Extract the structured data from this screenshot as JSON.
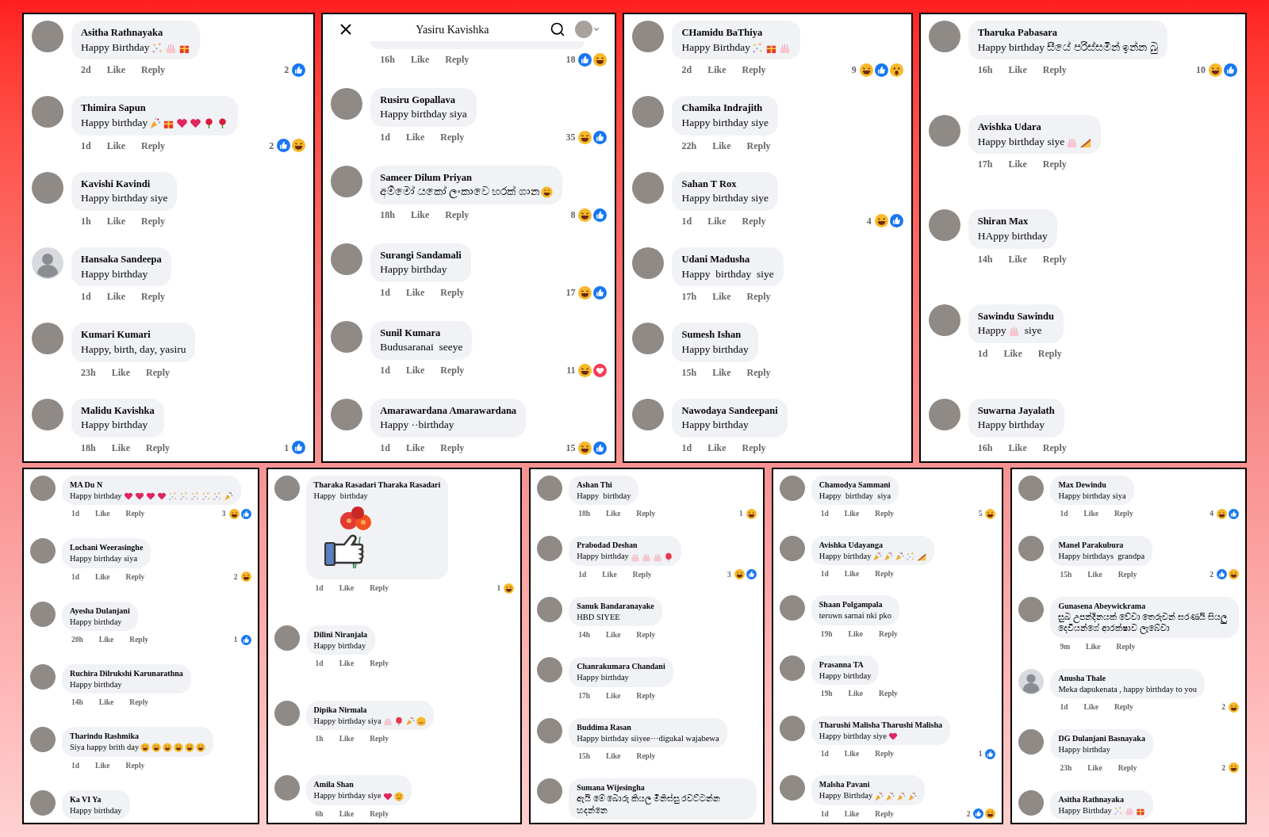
{
  "top_row": [
    {
      "comments": [
        {
          "avatar": {
            "kind": "photo"
          },
          "name": "Asitha Rathnayaka",
          "text": "Happy Birthday",
          "emojis": [
            {
              "kind": "confetti"
            },
            {
              "kind": "cake"
            },
            {
              "kind": "gift"
            }
          ],
          "time": "2d",
          "like": "Like",
          "reply": "Reply",
          "count": "2",
          "reactions": [
            {
              "kind": "like"
            }
          ]
        },
        {
          "avatar": {
            "kind": "photo"
          },
          "name": "Thimira Sapun",
          "text": "Happy birthday",
          "emojis": [
            {
              "kind": "party"
            },
            {
              "kind": "gift"
            },
            {
              "kind": "heart"
            },
            {
              "kind": "heart"
            },
            {
              "kind": "rose"
            },
            {
              "kind": "rose"
            }
          ],
          "time": "1d",
          "like": "Like",
          "reply": "Reply",
          "count": "2",
          "reactions": [
            {
              "kind": "like"
            },
            {
              "kind": "haha"
            }
          ]
        },
        {
          "avatar": {
            "kind": "photo"
          },
          "name": "Kavishi Kavindi",
          "text": "Happy birthday siye",
          "time": "1h",
          "like": "Like",
          "reply": "Reply"
        },
        {
          "avatar": {
            "kind": "default"
          },
          "name": "Hansaka Sandeepa",
          "text": "Happy birthday",
          "time": "1d",
          "like": "Like",
          "reply": "Reply"
        },
        {
          "avatar": {
            "kind": "photo"
          },
          "name": "Kumari Kumari",
          "text": "Happy, birth, day, yasiru",
          "time": "23h",
          "like": "Like",
          "reply": "Reply"
        },
        {
          "avatar": {
            "kind": "photo"
          },
          "name": "Malidu Kavishka",
          "text": "Happy birthday",
          "time": "18h",
          "like": "Like",
          "reply": "Reply",
          "count": "1",
          "reactions": [
            {
              "kind": "like"
            }
          ]
        }
      ]
    },
    {
      "header": {
        "title": "Yasiru Kavishka"
      },
      "comments": [
        {
          "time": "16h",
          "like": "Like",
          "reply": "Reply",
          "count": "18",
          "reactions": [
            {
              "kind": "like"
            },
            {
              "kind": "haha"
            }
          ]
        },
        {
          "avatar": {
            "kind": "photo"
          },
          "name": "Rusiru Gopallava",
          "text": "Happy birthday siya",
          "time": "1d",
          "like": "Like",
          "reply": "Reply",
          "count": "35",
          "reactions": [
            {
              "kind": "haha"
            },
            {
              "kind": "like"
            }
          ]
        },
        {
          "avatar": {
            "kind": "photo"
          },
          "name": "Sameer Dilum Priyan",
          "text": "අම්මෝ යකෝ ලංකාවෙ හරක් ගාන",
          "emojis": [
            {
              "kind": "rofl"
            }
          ],
          "time": "18h",
          "like": "Like",
          "reply": "Reply",
          "count": "8",
          "reactions": [
            {
              "kind": "haha"
            },
            {
              "kind": "like"
            }
          ]
        },
        {
          "avatar": {
            "kind": "photo"
          },
          "name": "Surangi Sandamali",
          "text": "Happy birthday",
          "time": "1d",
          "like": "Like",
          "reply": "Reply",
          "count": "17",
          "reactions": [
            {
              "kind": "haha"
            },
            {
              "kind": "like"
            }
          ]
        },
        {
          "avatar": {
            "kind": "photo"
          },
          "name": "Sunil Kumara",
          "text": "Budusaranai  seeye",
          "time": "1d",
          "like": "Like",
          "reply": "Reply",
          "count": "11",
          "reactions": [
            {
              "kind": "haha"
            },
            {
              "kind": "love"
            }
          ]
        },
        {
          "avatar": {
            "kind": "photo"
          },
          "name": "Amarawardana Amarawardana",
          "text": "Happy ··birthday",
          "time": "1d",
          "like": "Like",
          "reply": "Reply",
          "count": "15",
          "reactions": [
            {
              "kind": "haha"
            },
            {
              "kind": "like"
            }
          ]
        }
      ]
    },
    {
      "comments": [
        {
          "avatar": {
            "kind": "photo"
          },
          "name": "CHamidu BaThiya",
          "text": "Happy Birthday",
          "emojis": [
            {
              "kind": "confetti"
            },
            {
              "kind": "gift"
            },
            {
              "kind": "cake"
            }
          ],
          "time": "2d",
          "like": "Like",
          "reply": "Reply",
          "count": "9",
          "reactions": [
            {
              "kind": "haha"
            },
            {
              "kind": "like"
            },
            {
              "kind": "wow"
            }
          ]
        },
        {
          "avatar": {
            "kind": "photo"
          },
          "name": "Chamika Indrajith",
          "text": "Happy birthday siye",
          "time": "22h",
          "like": "Like",
          "reply": "Reply"
        },
        {
          "avatar": {
            "kind": "photo"
          },
          "name": "Sahan T Rox",
          "text": "Happy birthday siye",
          "time": "1d",
          "like": "Like",
          "reply": "Reply",
          "count": "4",
          "reactions": [
            {
              "kind": "haha"
            },
            {
              "kind": "like"
            }
          ]
        },
        {
          "avatar": {
            "kind": "photo"
          },
          "name": "Udani Madusha",
          "text": "Happy  birthday  siye",
          "time": "17h",
          "like": "Like",
          "reply": "Reply"
        },
        {
          "avatar": {
            "kind": "photo"
          },
          "name": "Sumesh Ishan",
          "text": "Happy birthday",
          "time": "15h",
          "like": "Like",
          "reply": "Reply"
        },
        {
          "avatar": {
            "kind": "photo"
          },
          "name": "Nawodaya Sandeepani",
          "text": "Happy birthday",
          "time": "1d",
          "like": "Like",
          "reply": "Reply"
        }
      ]
    },
    {
      "comments": [
        {
          "avatar": {
            "kind": "photo"
          },
          "name": "Tharuka Pabasara",
          "text": "Happy birthday සීයේ පරිස්සමින් ඉන්න බු",
          "time": "16h",
          "like": "Like",
          "reply": "Reply",
          "count": "10",
          "reactions": [
            {
              "kind": "haha"
            },
            {
              "kind": "like"
            }
          ]
        },
        {
          "avatar": {
            "kind": "photo"
          },
          "name": "Avishka Udara",
          "text": "Happy birthday siye",
          "emojis": [
            {
              "kind": "cake"
            },
            {
              "kind": "cake-slice"
            }
          ],
          "time": "17h",
          "like": "Like",
          "reply": "Reply"
        },
        {
          "avatar": {
            "kind": "photo"
          },
          "name": "Shiran Max",
          "text": "HAppy birthday",
          "time": "14h",
          "like": "Like",
          "reply": "Reply"
        },
        {
          "avatar": {
            "kind": "photo"
          },
          "name": "Sawindu Sawindu",
          "text": "Happy",
          "emojis": [
            {
              "kind": "cake"
            }
          ],
          "text_after": "siye",
          "time": "1d",
          "like": "Like",
          "reply": "Reply"
        },
        {
          "avatar": {
            "kind": "photo"
          },
          "name": "Suwarna Jayalath",
          "text": "Happy birthday",
          "time": "16h",
          "like": "Like",
          "reply": "Reply"
        }
      ]
    }
  ],
  "bottom_row": [
    {
      "comments": [
        {
          "avatar": {
            "kind": "photo"
          },
          "name": "MA Du N",
          "text": "Happy birthday",
          "emojis": [
            {
              "kind": "heart"
            },
            {
              "kind": "heart"
            },
            {
              "kind": "heart"
            },
            {
              "kind": "heart"
            },
            {
              "kind": "confetti"
            },
            {
              "kind": "confetti"
            },
            {
              "kind": "confetti"
            },
            {
              "kind": "confetti"
            },
            {
              "kind": "confetti"
            },
            {
              "kind": "party"
            }
          ],
          "time": "1d",
          "like": "Like",
          "reply": "Reply",
          "count": "3",
          "reactions": [
            {
              "kind": "haha"
            },
            {
              "kind": "like"
            }
          ]
        },
        {
          "avatar": {
            "kind": "photo"
          },
          "name": "Lochani Weerasinghe",
          "text": "Happy birthday siya",
          "time": "1d",
          "like": "Like",
          "reply": "Reply",
          "count": "2",
          "reactions": [
            {
              "kind": "haha"
            }
          ]
        },
        {
          "avatar": {
            "kind": "photo"
          },
          "name": "Ayesha Dulanjani",
          "text": "Happy birthday",
          "time": "20h",
          "like": "Like",
          "reply": "Reply",
          "count": "1",
          "reactions": [
            {
              "kind": "like"
            }
          ]
        },
        {
          "avatar": {
            "kind": "photo"
          },
          "name": "Ruchira Dilrukshi Karunarathna",
          "text": "Happy birthday",
          "time": "14h",
          "like": "Like",
          "reply": "Reply"
        },
        {
          "avatar": {
            "kind": "photo"
          },
          "name": "Tharindu Rashmika",
          "text": "Siya happy brith day",
          "emojis": [
            {
              "kind": "laugh"
            },
            {
              "kind": "laugh"
            },
            {
              "kind": "laugh"
            },
            {
              "kind": "laugh"
            },
            {
              "kind": "laugh"
            },
            {
              "kind": "laugh"
            }
          ],
          "time": "1d",
          "like": "Like",
          "reply": "Reply"
        },
        {
          "avatar": {
            "kind": "photo"
          },
          "name": "Ka VI Ya",
          "text": "Happy birthday"
        }
      ]
    },
    {
      "comments": [
        {
          "avatar": {
            "kind": "photo"
          },
          "name": "Tharaka Rasadari Tharaka Rasadari",
          "text": "Happy  birthday",
          "sticker": true,
          "time": "1d",
          "like": "Like",
          "reply": "Reply",
          "count": "1",
          "reactions": [
            {
              "kind": "haha"
            }
          ]
        },
        {
          "avatar": {
            "kind": "photo"
          },
          "name": "Dilini Niranjala",
          "text": "Happy birthday",
          "time": "1d",
          "like": "Like",
          "reply": "Reply"
        },
        {
          "avatar": {
            "kind": "photo"
          },
          "name": "Dipika Nirmala",
          "text": "Happy birthday siya",
          "emojis": [
            {
              "kind": "cake"
            },
            {
              "kind": "balloon"
            },
            {
              "kind": "party"
            },
            {
              "kind": "hug"
            }
          ],
          "time": "1h",
          "like": "Like",
          "reply": "Reply"
        },
        {
          "avatar": {
            "kind": "photo"
          },
          "name": "Amila Shan",
          "text": "Happy birthday siye",
          "emojis": [
            {
              "kind": "heart"
            },
            {
              "kind": "smile"
            }
          ],
          "time": "6h",
          "like": "Like",
          "reply": "Reply"
        }
      ]
    },
    {
      "comments": [
        {
          "avatar": {
            "kind": "photo"
          },
          "name": "Ashan Thi",
          "text": "Happy  birthday",
          "time": "18h",
          "like": "Like",
          "reply": "Reply",
          "count": "1",
          "reactions": [
            {
              "kind": "haha"
            }
          ]
        },
        {
          "avatar": {
            "kind": "photo"
          },
          "name": "Prabodad Deshan",
          "text": "Happy birthday",
          "emojis": [
            {
              "kind": "cake"
            },
            {
              "kind": "cake"
            },
            {
              "kind": "cake"
            },
            {
              "kind": "balloon"
            }
          ],
          "time": "1d",
          "like": "Like",
          "reply": "Reply",
          "count": "3",
          "reactions": [
            {
              "kind": "haha"
            },
            {
              "kind": "like"
            }
          ]
        },
        {
          "avatar": {
            "kind": "photo"
          },
          "name": "Sanuk Bandaranayake",
          "text": "HBD SIYEE",
          "time": "14h",
          "like": "Like",
          "reply": "Reply"
        },
        {
          "avatar": {
            "kind": "photo"
          },
          "name": "Chanrakumara Chandani",
          "text": "Happy birthday",
          "time": "17h",
          "like": "Like",
          "reply": "Reply"
        },
        {
          "avatar": {
            "kind": "photo"
          },
          "name": "Buddima Rasan",
          "text": "Happy birthday siiyee···digukal wajabewa",
          "time": "15h",
          "like": "Like",
          "reply": "Reply"
        },
        {
          "avatar": {
            "kind": "photo"
          },
          "name": "Sumana Wijesingha",
          "text": "ඇයි මේ බොරු කියල මිනිස්සු රවට්ටන්න හදන්නෙ"
        }
      ]
    },
    {
      "comments": [
        {
          "avatar": {
            "kind": "photo"
          },
          "name": "Chamodya Sammani",
          "text": "Happy  birthday  siya",
          "time": "1d",
          "like": "Like",
          "reply": "Reply",
          "count": "5",
          "reactions": [
            {
              "kind": "haha"
            }
          ]
        },
        {
          "avatar": {
            "kind": "photo"
          },
          "name": "Avishka Udayanga",
          "text": "Happy birthday",
          "emojis": [
            {
              "kind": "party"
            },
            {
              "kind": "party"
            },
            {
              "kind": "party"
            },
            {
              "kind": "confetti"
            },
            {
              "kind": "cake-slice"
            }
          ],
          "time": "1d",
          "like": "Like",
          "reply": "Reply"
        },
        {
          "avatar": {
            "kind": "photo"
          },
          "name": "Shaan Polgampala",
          "text": "teruwn sarnai nki pko",
          "time": "19h",
          "like": "Like",
          "reply": "Reply"
        },
        {
          "avatar": {
            "kind": "photo"
          },
          "name": "Prasanna TA",
          "text": "Happy birthday",
          "time": "19h",
          "like": "Like",
          "reply": "Reply"
        },
        {
          "avatar": {
            "kind": "photo"
          },
          "name": "Tharushi Malisha Tharushi Malisha",
          "text": "Happy birthday siye",
          "emojis": [
            {
              "kind": "heart"
            }
          ],
          "time": "1d",
          "like": "Like",
          "reply": "Reply",
          "count": "1",
          "reactions": [
            {
              "kind": "like"
            }
          ]
        },
        {
          "avatar": {
            "kind": "photo"
          },
          "name": "Malsha Pavani",
          "text": "Happy Birthday",
          "emojis": [
            {
              "kind": "party"
            },
            {
              "kind": "party"
            },
            {
              "kind": "party"
            },
            {
              "kind": "party"
            }
          ],
          "time": "1d",
          "like": "Like",
          "reply": "Reply",
          "count": "2",
          "reactions": [
            {
              "kind": "like"
            },
            {
              "kind": "haha"
            }
          ]
        }
      ]
    },
    {
      "comments": [
        {
          "avatar": {
            "kind": "photo"
          },
          "name": "Max Dewindu",
          "text": "Happy birthday siya",
          "time": "1d",
          "like": "Like",
          "reply": "Reply",
          "count": "4",
          "reactions": [
            {
              "kind": "haha"
            },
            {
              "kind": "like"
            }
          ]
        },
        {
          "avatar": {
            "kind": "photo"
          },
          "name": "Manel Parakubura",
          "text": "Happy birthdays  grandpa",
          "time": "15h",
          "like": "Like",
          "reply": "Reply",
          "count": "2",
          "reactions": [
            {
              "kind": "like"
            },
            {
              "kind": "haha"
            }
          ]
        },
        {
          "avatar": {
            "kind": "photo"
          },
          "name": "Gunasena Abeywickrama",
          "text": "සුබ උපන්දිනයක් වේවා තෙරුවන් සරණයි සියලු දෙවියන්ගේ ආරක්ෂාව ලැබේවා",
          "time": "9m",
          "like": "Like",
          "reply": "Reply"
        },
        {
          "avatar": {
            "kind": "default"
          },
          "name": "Anusha Thale",
          "text": "Meka dapukenata , happy birthday to you",
          "time": "1d",
          "like": "Like",
          "reply": "Reply",
          "count": "2",
          "reactions": [
            {
              "kind": "haha"
            }
          ]
        },
        {
          "avatar": {
            "kind": "photo"
          },
          "name": "DG Dulanjani Basnayaka",
          "text": "Happy birthday",
          "time": "23h",
          "like": "Like",
          "reply": "Reply",
          "count": "2",
          "reactions": [
            {
              "kind": "haha"
            }
          ]
        },
        {
          "avatar": {
            "kind": "photo"
          },
          "name": "Asitha Rathnayaka",
          "text": "Happy Birthday",
          "emojis": [
            {
              "kind": "confetti"
            },
            {
              "kind": "cake"
            },
            {
              "kind": "gift"
            }
          ]
        }
      ]
    }
  ]
}
